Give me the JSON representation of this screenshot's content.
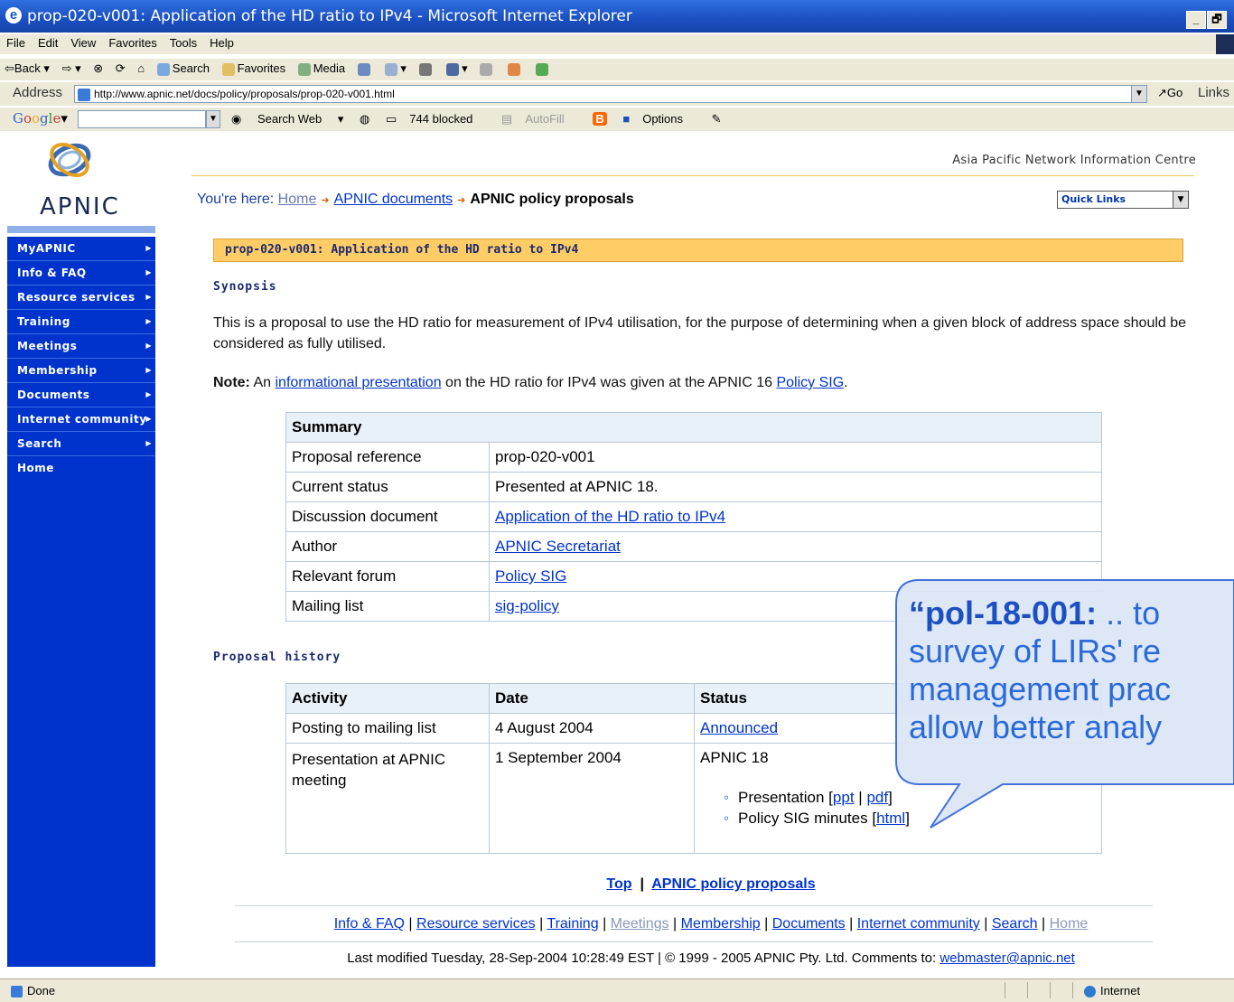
{
  "window": {
    "title": "prop-020-v001: Application of the HD ratio to IPv4 - Microsoft Internet Explorer",
    "controls": [
      "_",
      "🗗"
    ]
  },
  "menu": [
    "File",
    "Edit",
    "View",
    "Favorites",
    "Tools",
    "Help"
  ],
  "toolbar": {
    "back": "Back",
    "search": "Search",
    "favorites": "Favorites",
    "media": "Media"
  },
  "address": {
    "label": "Address",
    "url": "http://www.apnic.net/docs/policy/proposals/prop-020-v001.html",
    "go": "Go",
    "links": "Links"
  },
  "googlebar": {
    "logo": "Google",
    "search_web": "Search Web",
    "blocked": "744 blocked",
    "autofill": "AutoFill",
    "options": "Options"
  },
  "site": {
    "logo_text": "APNIC",
    "org_name": "Asia Pacific Network Information Centre",
    "quick_links": "Quick Links"
  },
  "nav": [
    "MyAPNIC",
    "Info & FAQ",
    "Resource services",
    "Training",
    "Meetings",
    "Membership",
    "Documents",
    "Internet community",
    "Search",
    "Home"
  ],
  "breadcrumb": {
    "prefix": "You're here:",
    "home": "Home",
    "docs": "APNIC documents",
    "current": "APNIC policy proposals"
  },
  "page": {
    "banner": "prop-020-v001: Application of the HD ratio to IPv4",
    "synopsis_heading": "Synopsis",
    "synopsis_text": "This is a proposal to use the HD ratio for measurement of IPv4 utilisation, for the purpose of determining when a given block of address space should be considered as fully utilised.",
    "note_label": "Note:",
    "note_pre": "An",
    "note_link1": "informational presentation",
    "note_mid": "on the HD ratio for IPv4 was given at the APNIC 16",
    "note_link2": "Policy SIG",
    "note_end": "."
  },
  "summary": {
    "heading": "Summary",
    "rows": [
      {
        "label": "Proposal reference",
        "value": "prop-020-v001"
      },
      {
        "label": "Current status",
        "value": "Presented at APNIC 18."
      },
      {
        "label": "Discussion document",
        "value": "Application of the HD ratio to IPv4"
      },
      {
        "label": "Author",
        "value": "APNIC Secretariat"
      },
      {
        "label": "Relevant forum",
        "value": "Policy SIG"
      },
      {
        "label": "Mailing list",
        "value": "sig-policy"
      }
    ]
  },
  "history": {
    "heading": "Proposal history",
    "columns": [
      "Activity",
      "Date",
      "Status"
    ],
    "rows": [
      {
        "activity": "Posting to mailing list",
        "date": "4 August 2004",
        "status": "Announced"
      },
      {
        "activity": "Presentation at APNIC meeting",
        "date": "1 September 2004",
        "status": "APNIC 18",
        "presentation_label": "Presentation [",
        "ppt": "ppt",
        "pipe": "|",
        "pdf": "pdf",
        "close": "]",
        "minutes_label": "Policy SIG minutes [",
        "html": "html"
      }
    ]
  },
  "footer": {
    "top": "Top",
    "divider": "|",
    "proposals": "APNIC policy proposals",
    "links": [
      "Info & FAQ",
      "Resource services",
      "Training",
      "Meetings",
      "Membership",
      "Documents",
      "Internet community",
      "Search",
      "Home"
    ],
    "modified": "Last modified Tuesday, 28-Sep-2004 10:28:49 EST | © 1999 - 2005 APNIC Pty. Ltd. Comments to:",
    "email": "webmaster@apnic.net"
  },
  "callout": {
    "bold": "“pol-18-001:",
    "lines": [
      ".. to",
      "survey of LIRs' re",
      "management prac",
      "allow better analy"
    ]
  },
  "status": {
    "done": "Done",
    "zone": "Internet"
  }
}
